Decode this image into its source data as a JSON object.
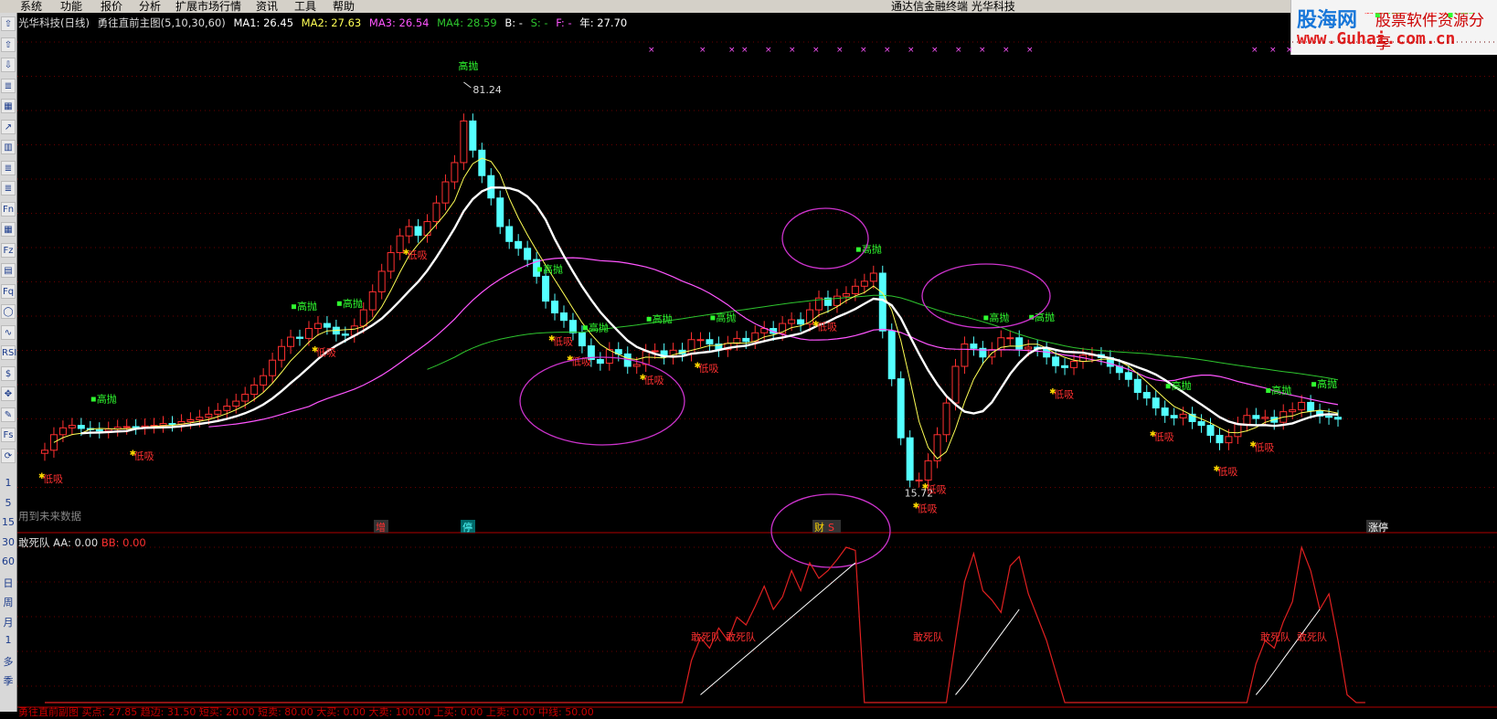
{
  "menu": {
    "items": [
      "系统",
      "功能",
      "报价",
      "分析",
      "扩展市场行情",
      "资讯",
      "工具",
      "帮助"
    ],
    "center_title": "通达信金融终端   光华科技"
  },
  "watermark": {
    "brand": "股海网",
    "tagline": "股票软件资源分享",
    "url": "www.Guhai.com.cn"
  },
  "toolbar": {
    "buttons": [
      "arrow-up-icon",
      "arrow-up-icon",
      "arrow-down-icon",
      "list-icon",
      "grid-icon",
      "trend-icon",
      "candle-icon",
      "list-icon",
      "list-icon",
      "Fn",
      "grid-icon",
      "Fz",
      "tag-icon",
      "Fq",
      "circle-icon",
      "wave-icon",
      "RSI",
      "money-icon",
      "move-icon",
      "pencil-icon",
      "Fs",
      "refresh-icon"
    ],
    "periods": [
      "1",
      "5",
      "15",
      "30",
      "60",
      "日",
      "周",
      "月",
      "1",
      "多",
      "季"
    ]
  },
  "main_header": {
    "name": "光华科技(日线)",
    "indicator": "勇往直前主图(5,10,30,60)",
    "ma1": "MA1: 26.45",
    "ma2": "MA2: 27.63",
    "ma3": "MA3: 26.54",
    "ma4": "MA4: 28.59",
    "b": "B: -",
    "s": "S: -",
    "f": "F: -",
    "year": "年: 27.70"
  },
  "future_label": "用到未来数据",
  "sub_header": {
    "name": "敢死队",
    "aa": "AA: 0.00",
    "bb": "BB: 0.00"
  },
  "bottom_header": "勇往直前副图  买点: 27.85  趋边: 31.50  短买: 20.00  短卖: 80.00  大买: 0.00  大卖: 100.00  上买: 0.00  上卖: 0.00  中线: 50.00",
  "labels": {
    "high_sell": "高抛",
    "low_buy": "低吸",
    "dare_team": "敢死队",
    "peak_price": "81.24",
    "low_price": "15.72",
    "peak_top": "高抛",
    "events": [
      "增",
      "停",
      "财",
      "S",
      "涨停"
    ]
  },
  "colors": {
    "candle_up": "#ff3030",
    "candle_down": "#54ffff",
    "ma1": "#ffffff",
    "ma2": "#ffff55",
    "ma3": "#ff55ff",
    "ma4": "#2ec52e",
    "signal_sell": "#30ff30",
    "signal_buy": "#ff3030",
    "circle": "#cc33cc",
    "divider": "#b00000"
  },
  "chart_data": {
    "type": "candlestick",
    "price_range": [
      13,
      88
    ],
    "peak": 81.24,
    "trough": 15.72,
    "closes": [
      22.0,
      24.5,
      25.6,
      26.0,
      25.5,
      25.3,
      25.1,
      25.4,
      25.7,
      25.8,
      25.7,
      25.9,
      26.0,
      26.3,
      26.2,
      26.6,
      26.9,
      27.3,
      27.8,
      28.4,
      29.1,
      29.9,
      31.0,
      32.5,
      34.0,
      36.5,
      38.7,
      40.2,
      40.0,
      41.6,
      42.4,
      41.8,
      40.7,
      40.5,
      42.0,
      44.6,
      47.5,
      50.8,
      53.8,
      56.5,
      58.0,
      56.6,
      58.8,
      61.8,
      65.2,
      68.3,
      75.0,
      70.3,
      66.2,
      62.6,
      58.0,
      55.6,
      54.5,
      52.7,
      50.0,
      46.0,
      44.1,
      42.9,
      40.9,
      38.8,
      36.6,
      36.0,
      38.2,
      37.5,
      35.5,
      35.8,
      37.9,
      38.0,
      37.0,
      38.1,
      37.5,
      39.8,
      39.8,
      39.1,
      38.2,
      39.2,
      40.0,
      39.5,
      40.9,
      41.6,
      40.8,
      42.4,
      43.0,
      42.3,
      44.6,
      46.5,
      45.3,
      46.8,
      47.2,
      48.4,
      49.2,
      50.5,
      41.2,
      33.5,
      24.0,
      17.2,
      17.2,
      20.3,
      24.5,
      29.6,
      35.5,
      39.1,
      38.4,
      37.0,
      38.2,
      40.1,
      40.1,
      38.3,
      38.6,
      38.3,
      37.0,
      35.6,
      35.3,
      36.3,
      37.3,
      37.4,
      36.9,
      35.5,
      34.5,
      33.4,
      31.3,
      30.4,
      28.8,
      27.6,
      27.2,
      27.8,
      26.6,
      26.0,
      24.4,
      23.2,
      24.2,
      26.2,
      27.6,
      27.1,
      27.3,
      26.5,
      28.2,
      28.5,
      29.7,
      28.3,
      27.5,
      27.3,
      27.0
    ],
    "sub_indicator": {
      "name": "敢死队",
      "aa": 0.0,
      "bb": 0.0,
      "red_series": [
        0,
        0,
        0,
        0,
        0,
        0,
        0,
        0,
        0,
        0,
        0,
        0,
        0,
        0,
        0,
        0,
        0,
        0,
        0,
        0,
        0,
        0,
        0,
        0,
        0,
        0,
        0,
        0,
        0,
        0,
        0,
        0,
        0,
        0,
        0,
        0,
        0,
        0,
        0,
        0,
        0,
        0,
        0,
        0,
        0,
        0,
        0,
        0,
        0,
        0,
        0,
        0,
        0,
        0,
        0,
        0,
        0,
        0,
        0,
        0,
        0,
        0,
        0,
        0,
        0,
        0,
        0,
        0,
        0,
        0,
        0,
        27,
        42,
        35,
        48,
        40,
        55,
        50,
        62,
        75,
        60,
        68,
        85,
        72,
        90,
        80,
        85,
        92,
        100,
        98,
        0,
        0,
        0,
        0,
        0,
        0,
        0,
        0,
        0,
        0,
        40,
        78,
        96,
        72,
        66,
        58,
        88,
        94,
        70,
        55,
        40,
        20,
        0,
        0,
        0,
        0,
        0,
        0,
        0,
        0,
        0,
        0,
        0,
        0,
        0,
        0,
        0,
        0,
        0,
        0,
        0,
        0,
        0,
        25,
        40,
        35,
        52,
        65,
        100,
        85,
        60,
        70,
        40,
        5,
        0,
        0
      ],
      "white_series": [
        0,
        0,
        0,
        0,
        0,
        0,
        0,
        0,
        0,
        0,
        0,
        0,
        0,
        0,
        0,
        0,
        0,
        0,
        0,
        0,
        0,
        0,
        0,
        0,
        0,
        0,
        0,
        0,
        0,
        0,
        0,
        0,
        0,
        0,
        0,
        0,
        0,
        0,
        0,
        0,
        0,
        0,
        0,
        0,
        0,
        0,
        0,
        0,
        0,
        0,
        0,
        0,
        0,
        0,
        0,
        0,
        0,
        0,
        0,
        0,
        0,
        0,
        0,
        0,
        0,
        0,
        0,
        0,
        0,
        0,
        0,
        0,
        5,
        10,
        15,
        20,
        25,
        30,
        35,
        40,
        45,
        50,
        55,
        60,
        65,
        70,
        75,
        80,
        85,
        90,
        0,
        0,
        0,
        0,
        0,
        0,
        0,
        0,
        0,
        0,
        5,
        12,
        20,
        28,
        36,
        44,
        52,
        60,
        0,
        0,
        0,
        0,
        0,
        0,
        0,
        0,
        0,
        0,
        0,
        0,
        0,
        0,
        0,
        0,
        0,
        0,
        0,
        0,
        0,
        0,
        0,
        0,
        0,
        5,
        12,
        20,
        28,
        36,
        44,
        52,
        60,
        0,
        0,
        0,
        0,
        0
      ]
    }
  }
}
